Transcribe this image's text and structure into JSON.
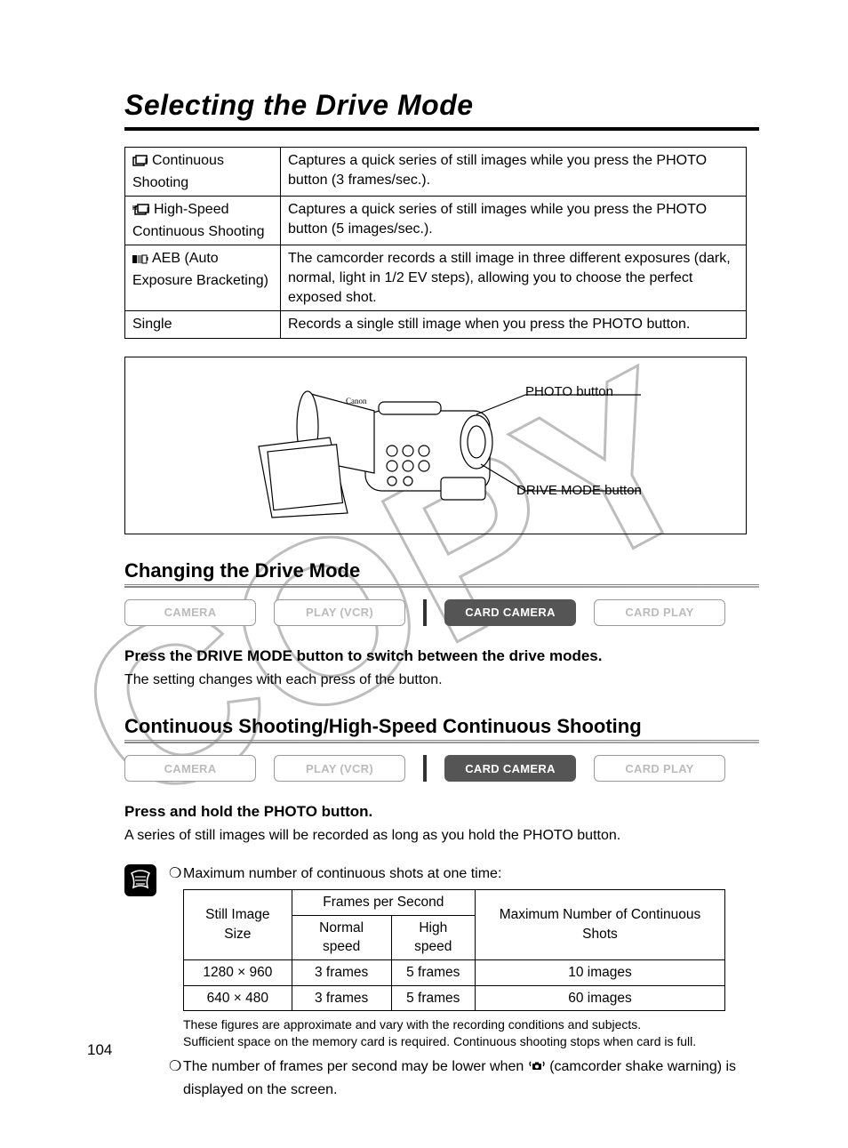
{
  "title": "Selecting the Drive Mode",
  "modes": [
    {
      "name": "Continuous Shooting",
      "desc": "Captures a quick series of still images while you press the PHOTO button (3 frames/sec.)."
    },
    {
      "name": "High-Speed Continuous Shooting",
      "desc": "Captures a quick series of still images while you press the PHOTO button (5 images/sec.)."
    },
    {
      "name": "AEB (Auto Exposure Bracketing)",
      "desc": "The camcorder records a still image in three different exposures (dark, normal, light in 1/2 EV steps), allowing you to choose the perfect exposed shot."
    },
    {
      "name": "Single",
      "desc": "Records a single still image when you press the PHOTO button."
    }
  ],
  "diagram": {
    "callout1": "PHOTO button",
    "callout2": "DRIVE MODE button"
  },
  "section1": {
    "heading": "Changing the Drive Mode",
    "buttons": [
      "CAMERA",
      "PLAY (VCR)",
      "CARD CAMERA",
      "CARD PLAY"
    ],
    "step": "Press the DRIVE MODE button to switch between the drive modes.",
    "desc": "The setting changes with each press of the button."
  },
  "section2": {
    "heading": "Continuous Shooting/High-Speed Continuous Shooting",
    "buttons": [
      "CAMERA",
      "PLAY (VCR)",
      "CARD CAMERA",
      "CARD PLAY"
    ],
    "step": "Press and hold the PHOTO button.",
    "desc": "A series of still images will be recorded as long as you hold the PHOTO button."
  },
  "notes": {
    "bullet1": "Maximum number of continuous shots at one time:",
    "table_headers": {
      "size": "Still Image Size",
      "fps": "Frames per Second",
      "normal": "Normal speed",
      "high": "High speed",
      "max": "Maximum Number of Continuous Shots"
    },
    "rows": [
      {
        "size": "1280 × 960",
        "normal": "3 frames",
        "high": "5 frames",
        "max": "10 images"
      },
      {
        "size": "640 × 480",
        "normal": "3 frames",
        "high": "5 frames",
        "max": "60 images"
      }
    ],
    "footnote1": "These figures are approximate and vary with the recording conditions and subjects.",
    "footnote2": "Sufficient space on the memory card is required. Continuous shooting stops when card is full.",
    "bullet2a": "The number of frames per second may be lower when ",
    "bullet2b": " (camcorder shake warning) is displayed on the screen."
  },
  "page_number": "104",
  "chart_data": {
    "type": "table",
    "title": "Maximum number of continuous shots at one time",
    "columns": [
      "Still Image Size",
      "Normal speed (frames/sec)",
      "High speed (frames/sec)",
      "Maximum Number of Continuous Shots"
    ],
    "rows": [
      [
        "1280 × 960",
        3,
        5,
        10
      ],
      [
        "640 × 480",
        3,
        5,
        60
      ]
    ]
  }
}
